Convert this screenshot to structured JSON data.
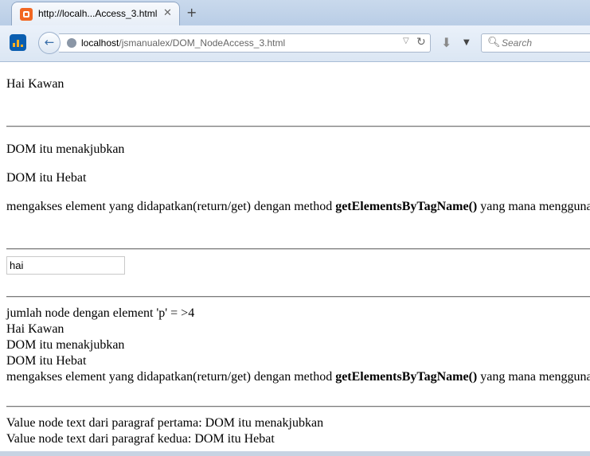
{
  "browser": {
    "tab_title": "http://localh...Access_3.html",
    "tab_close": "✕",
    "new_tab": "+",
    "url_prefix": "localhost",
    "url_path": "/jsmanualex/DOM_NodeAccess_3.html",
    "search_placeholder": "Search"
  },
  "page": {
    "p1": "Hai Kawan",
    "p2": "DOM itu menakjubkan",
    "p3": "DOM itu Hebat",
    "p4_before": "mengakses element yang didapatkan(return/get) dengan method ",
    "p4_method": "getElementsByTagName()",
    "p4_after": " yang mana menggunakan",
    "input_value": "hai",
    "count_line": "jumlah node dengan element 'p' = >4",
    "list": [
      "Hai Kawan",
      "DOM itu menakjubkan",
      "DOM itu Hebat"
    ],
    "list4_before": "mengakses element yang didapatkan(return/get) dengan method ",
    "list4_method": "getElementsByTagName()",
    "list4_after": " yang mana menggunakan",
    "value_first": "Value node text dari paragraf pertama: DOM itu menakjubkan",
    "value_second": "Value node text dari paragraf kedua: DOM itu Hebat"
  }
}
